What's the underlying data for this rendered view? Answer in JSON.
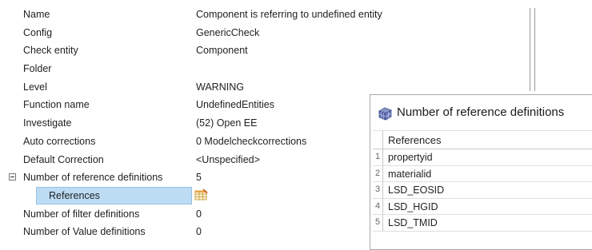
{
  "properties": [
    {
      "name": "Name",
      "value": "Component is referring to undefined entity"
    },
    {
      "name": "Config",
      "value": "GenericCheck"
    },
    {
      "name": "Check entity",
      "value": "Component"
    },
    {
      "name": "Folder",
      "value": ""
    },
    {
      "name": "Level",
      "value": "WARNING"
    },
    {
      "name": "Function name",
      "value": "UndefinedEntities"
    },
    {
      "name": "Investigate",
      "value": "(52) Open EE"
    },
    {
      "name": "Auto corrections",
      "value": "0 Modelcheckcorrections"
    },
    {
      "name": "Default Correction",
      "value": "<Unspecified>"
    },
    {
      "name": "Number of reference definitions",
      "value": "5"
    },
    {
      "name": "References",
      "value": ""
    },
    {
      "name": "Number of filter definitions",
      "value": "0"
    },
    {
      "name": "Number of Value definitions",
      "value": "0"
    }
  ],
  "popup": {
    "title": "Number of reference definitions",
    "column_header": "References",
    "rows": [
      {
        "num": "1",
        "value": "propertyid"
      },
      {
        "num": "2",
        "value": "materialid"
      },
      {
        "num": "3",
        "value": "LSD_EOSID"
      },
      {
        "num": "4",
        "value": "LSD_HGID"
      },
      {
        "num": "5",
        "value": "LSD_TMID"
      }
    ]
  },
  "icons": {
    "collapse": "minus-box-icon",
    "references_editor": "table-edit-icon",
    "popup": "table-grid-icon"
  },
  "colors": {
    "selection_bg": "#bcdcf4",
    "selection_border": "#96c3e6"
  }
}
